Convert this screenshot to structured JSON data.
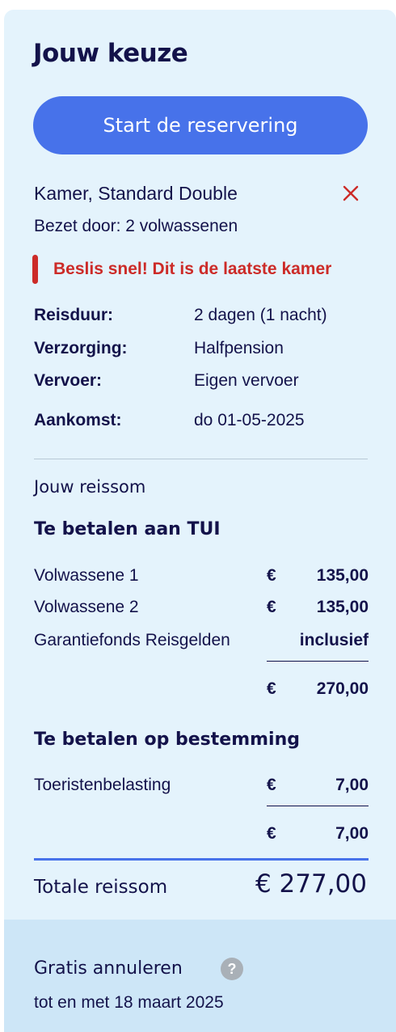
{
  "title": "Jouw keuze",
  "cta_label": "Start de reservering",
  "room": {
    "name": "Kamer, Standard Double",
    "occupancy": "Bezet door: 2 volwassenen",
    "remove_icon": "close-icon"
  },
  "alert": {
    "text": "Beslis snel! Dit is de laatste kamer",
    "color": "#cc2b28"
  },
  "details": [
    {
      "label": "Reisduur:",
      "value": "2 dagen (1 nacht)"
    },
    {
      "label": "Verzorging:",
      "value": "Halfpension"
    },
    {
      "label": "Vervoer:",
      "value": "Eigen vervoer"
    },
    {
      "label": "Aankomst:",
      "value": "do 01-05-2025"
    }
  ],
  "price": {
    "heading": "Jouw reissom",
    "tui": {
      "title": "Te betalen aan TUI",
      "rows": [
        {
          "label": "Volwassene 1",
          "currency": "€",
          "amount": "135,00"
        },
        {
          "label": "Volwassene 2",
          "currency": "€",
          "amount": "135,00"
        },
        {
          "label": "Garantiefonds Reisgelden",
          "currency": "",
          "amount": "inclusief"
        }
      ],
      "subtotal": {
        "currency": "€",
        "amount": "270,00"
      }
    },
    "destination": {
      "title": "Te betalen op bestemming",
      "rows": [
        {
          "label": "Toeristenbelasting",
          "currency": "€",
          "amount": "7,00"
        }
      ],
      "subtotal": {
        "currency": "€",
        "amount": "7,00"
      }
    },
    "total_label": "Totale reissom",
    "total_amount": "€ 277,00"
  },
  "cancellation": {
    "title": "Gratis annuleren",
    "help_glyph": "?",
    "date": "tot en met 18 maart 2025"
  },
  "colors": {
    "accent": "#4772ea",
    "panel_bg": "#e4f3fc",
    "text": "#13124a"
  }
}
